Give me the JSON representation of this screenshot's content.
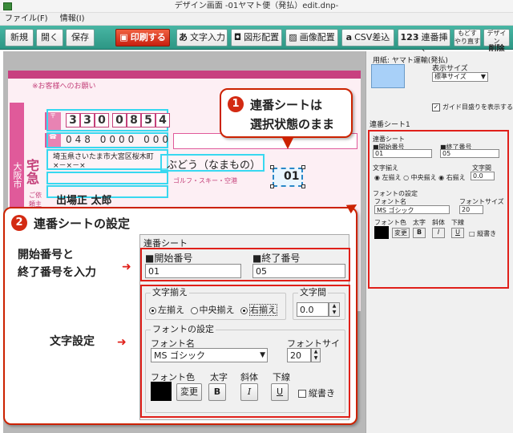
{
  "window": {
    "title": "デザイン画面 -01ヤマト便（発払）edit.dnp-"
  },
  "menu": [
    "ファイル(F)",
    "情報(I)"
  ],
  "toolbar": {
    "new": "新規",
    "open": "開く",
    "save": "保存",
    "print": "印刷する",
    "text_input": "文字入力",
    "text_icon": "あ",
    "shape": "図形配置",
    "image": "画像配置",
    "csv": "CSV差込",
    "csv_icon": "a",
    "serial": "連番挿入",
    "serial_icon": "123",
    "undo": "もどす",
    "redo": "やり直す",
    "design": "デザイン",
    "delete": "削除"
  },
  "right_pane": {
    "paper_label": "用紙: ヤマト運輸(発払)",
    "display_size_label": "表示サイズ",
    "display_size_value": "標準サイズ",
    "guide_label": "ガイド目盛りを表示する",
    "guide_checked": true
  },
  "slip": {
    "notice": "※お客様へのお願い",
    "zip": [
      "3",
      "3",
      "0",
      "0",
      "8",
      "5",
      "4"
    ],
    "phone": [
      "0",
      "4",
      "8",
      "0",
      "0",
      "0",
      "0",
      "0",
      "0",
      "0"
    ],
    "address": "埼玉県さいたま市大宮区桜木町",
    "address2": "×－×－×",
    "goods": "ぶどう（なまもの）",
    "sender_name": "出場正 太郎",
    "sender_label": "ご依頼主",
    "serial_tag": "01",
    "vertical_1": "大阪市",
    "vertical_2": "宅急"
  },
  "callout1": {
    "num": "1",
    "line1": "連番シートは",
    "line2": "選択状態のまま"
  },
  "callout2": {
    "num": "2",
    "title": "連番シートの設定"
  },
  "label_numbers": [
    "開始番号と",
    "終了番号を入力"
  ],
  "label_text": "文字設定",
  "sheet": {
    "tab_label": "連番シート1",
    "header": "連番シート",
    "start_label": "■開始番号",
    "start_value": "01",
    "end_label": "■終了番号",
    "end_value": "05",
    "align_group": "文字揃え",
    "align_left": "左揃え",
    "align_center": "中央揃え",
    "align_right": "右揃え",
    "spacing_label": "文字間",
    "spacing_value": "0.0",
    "font_group": "フォントの設定",
    "font_name_label": "フォント名",
    "font_name_value": "MS ゴシック",
    "font_size_label": "フォントサイズ",
    "font_size_value": "20",
    "font_color_label": "フォント色",
    "bold_label": "太字",
    "italic_label": "斜体",
    "underline_label": "下線",
    "change_button": "変更",
    "bold_button": "B",
    "italic_button": "I",
    "underline_button": "U",
    "vertical_label": "縦書き",
    "font_color": "#000000"
  },
  "colors": {
    "toolbar": "#3aa896",
    "accent_red": "#e0201a",
    "guide_cyan": "#38d8f0",
    "slip_pink": "#fdeff4"
  }
}
